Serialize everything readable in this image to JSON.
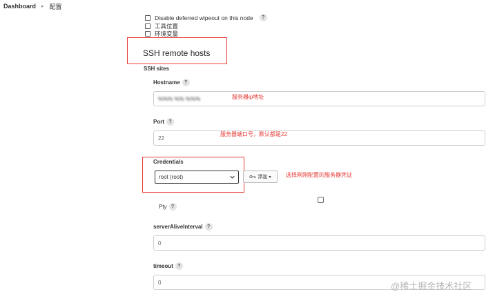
{
  "breadcrumb": {
    "root": "Dashboard",
    "separator": "▸",
    "current": "配置"
  },
  "checkboxes": [
    {
      "label": "Disable deferred wipeout on this node",
      "help": "?"
    },
    {
      "label": "工具位置"
    },
    {
      "label": "环境变量"
    }
  ],
  "section": {
    "title": "SSH remote hosts",
    "subtitle": "SSH sites"
  },
  "fields": {
    "hostname": {
      "label": "Hostname",
      "help": "?",
      "value": "%%% %% %%%"
    },
    "port": {
      "label": "Port",
      "help": "?",
      "value": "22"
    },
    "credentials": {
      "label": "Credentials",
      "selected": "root (root)",
      "add_label": "添加",
      "add_icon": "key-icon"
    },
    "pty": {
      "label": "Pty",
      "help": "?"
    },
    "server_alive_interval": {
      "label": "serverAliveInterval",
      "help": "?",
      "value": "0"
    },
    "timeout": {
      "label": "timeout",
      "help": "?",
      "value": "0"
    }
  },
  "annotations": {
    "hostname": "服务器ip地址",
    "port": "服务器端口号，默认都是22",
    "credentials": "选择刚刚配置的服务器凭证"
  },
  "colors": {
    "annotation": "#e53935",
    "label": "#333333",
    "watermark": "#b5b5b5"
  },
  "watermark": "@稀土掘金技术社区"
}
